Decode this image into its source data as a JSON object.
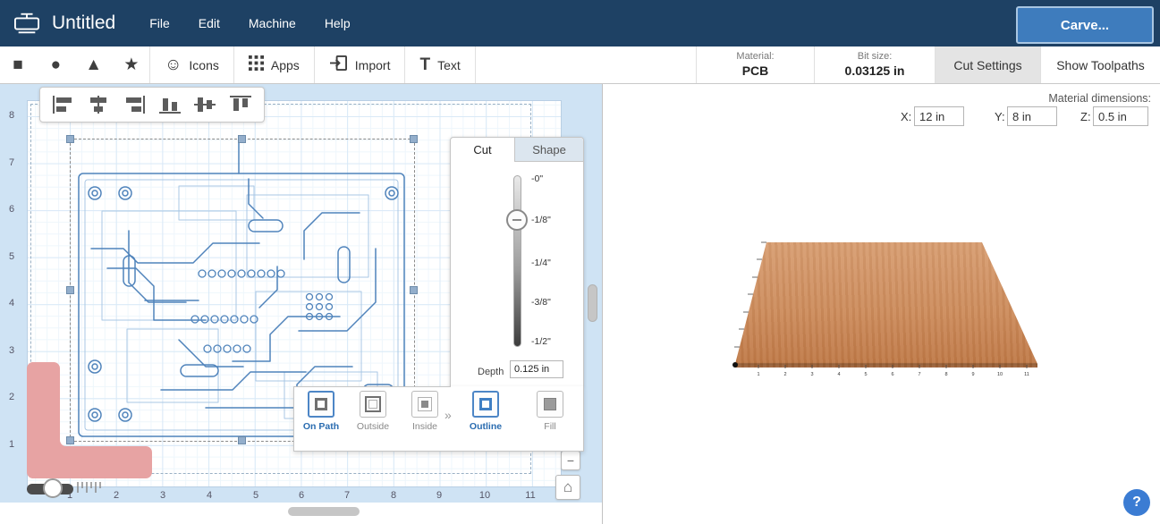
{
  "header": {
    "title": "Untitled",
    "menus": [
      "File",
      "Edit",
      "Machine",
      "Help"
    ],
    "carve_label": "Carve..."
  },
  "toolbar": {
    "shape_icons": {
      "square": "■",
      "circle": "●",
      "triangle": "▲",
      "star": "★"
    },
    "icons_icon": "☺",
    "icons_label": "Icons",
    "apps_label": "Apps",
    "import_label": "Import",
    "text_icon": "T",
    "text_label": "Text",
    "material_label": "Material:",
    "material_value": "PCB",
    "bit_size_label": "Bit size:",
    "bit_size_value": "0.03125 in",
    "cut_settings_label": "Cut Settings",
    "show_toolpaths_label": "Show Toolpaths"
  },
  "material_dimensions": {
    "label": "Material dimensions:",
    "x_label": "X:",
    "x_value": "12 in",
    "y_label": "Y:",
    "y_value": "8 in",
    "z_label": "Z:",
    "z_value": "0.5 in"
  },
  "canvas": {
    "v_ruler": [
      "8",
      "7",
      "6",
      "5",
      "4",
      "3",
      "2",
      "1"
    ],
    "h_ruler": [
      "1",
      "2",
      "3",
      "4",
      "5",
      "6",
      "7",
      "8",
      "9",
      "10",
      "11"
    ]
  },
  "cut_panel": {
    "tab_cut": "Cut",
    "tab_shape": "Shape",
    "depth_ticks": [
      "-0\"",
      "-1/8\"",
      "-1/4\"",
      "-3/8\"",
      "-1/2\""
    ],
    "depth_label": "Depth",
    "depth_value": "0.125 in",
    "chevron": "»",
    "on_path_label": "On Path",
    "outside_label": "Outside",
    "inside_label": "Inside",
    "outline_label": "Outline",
    "fill_label": "Fill"
  },
  "preview": {
    "axis_numbers": [
      "1",
      "2",
      "3",
      "4",
      "5",
      "6",
      "7",
      "8",
      "9",
      "10",
      "11"
    ]
  },
  "controls": {
    "zoom_out_label": "−",
    "home_icon": "⌂",
    "grip_dots": "⋮",
    "help_label": "?"
  },
  "colors": {
    "navy_header": "#1e4164",
    "accent_blue": "#3e7cbd",
    "trace_blue": "#4f83bb",
    "copper_material": "#c5824f",
    "pink_shape": "#e7a3a3"
  }
}
